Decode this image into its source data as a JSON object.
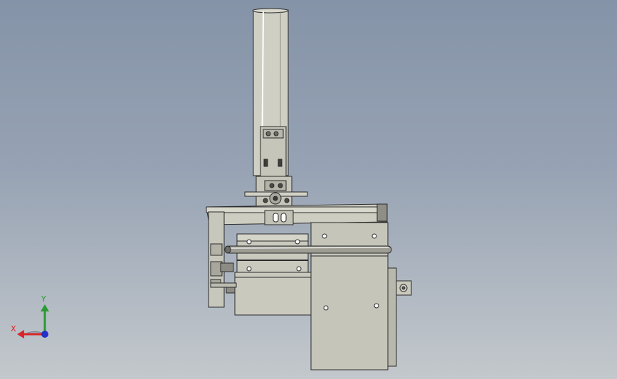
{
  "viewport": {
    "background_top": "#8593a8",
    "background_bottom": "#c3c8cc",
    "part_color": "#c9c9bd",
    "edge_color": "#2b2b2b"
  },
  "triad": {
    "x_label": "X",
    "y_label": "Y",
    "x_color": "#d8262b",
    "y_color": "#2a9a33",
    "z_color": "#2430c8"
  }
}
